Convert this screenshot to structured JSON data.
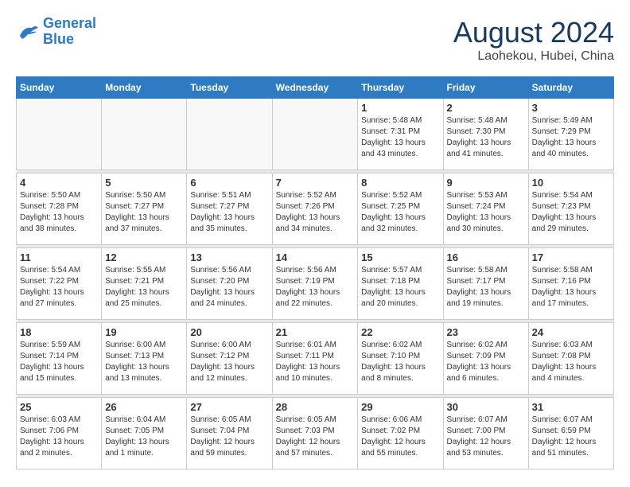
{
  "logo": {
    "line1": "General",
    "line2": "Blue"
  },
  "title": "August 2024",
  "subtitle": "Laohekou, Hubei, China",
  "weekdays": [
    "Sunday",
    "Monday",
    "Tuesday",
    "Wednesday",
    "Thursday",
    "Friday",
    "Saturday"
  ],
  "weeks": [
    [
      {
        "day": "",
        "info": ""
      },
      {
        "day": "",
        "info": ""
      },
      {
        "day": "",
        "info": ""
      },
      {
        "day": "",
        "info": ""
      },
      {
        "day": "1",
        "info": "Sunrise: 5:48 AM\nSunset: 7:31 PM\nDaylight: 13 hours\nand 43 minutes."
      },
      {
        "day": "2",
        "info": "Sunrise: 5:48 AM\nSunset: 7:30 PM\nDaylight: 13 hours\nand 41 minutes."
      },
      {
        "day": "3",
        "info": "Sunrise: 5:49 AM\nSunset: 7:29 PM\nDaylight: 13 hours\nand 40 minutes."
      }
    ],
    [
      {
        "day": "4",
        "info": "Sunrise: 5:50 AM\nSunset: 7:28 PM\nDaylight: 13 hours\nand 38 minutes."
      },
      {
        "day": "5",
        "info": "Sunrise: 5:50 AM\nSunset: 7:27 PM\nDaylight: 13 hours\nand 37 minutes."
      },
      {
        "day": "6",
        "info": "Sunrise: 5:51 AM\nSunset: 7:27 PM\nDaylight: 13 hours\nand 35 minutes."
      },
      {
        "day": "7",
        "info": "Sunrise: 5:52 AM\nSunset: 7:26 PM\nDaylight: 13 hours\nand 34 minutes."
      },
      {
        "day": "8",
        "info": "Sunrise: 5:52 AM\nSunset: 7:25 PM\nDaylight: 13 hours\nand 32 minutes."
      },
      {
        "day": "9",
        "info": "Sunrise: 5:53 AM\nSunset: 7:24 PM\nDaylight: 13 hours\nand 30 minutes."
      },
      {
        "day": "10",
        "info": "Sunrise: 5:54 AM\nSunset: 7:23 PM\nDaylight: 13 hours\nand 29 minutes."
      }
    ],
    [
      {
        "day": "11",
        "info": "Sunrise: 5:54 AM\nSunset: 7:22 PM\nDaylight: 13 hours\nand 27 minutes."
      },
      {
        "day": "12",
        "info": "Sunrise: 5:55 AM\nSunset: 7:21 PM\nDaylight: 13 hours\nand 25 minutes."
      },
      {
        "day": "13",
        "info": "Sunrise: 5:56 AM\nSunset: 7:20 PM\nDaylight: 13 hours\nand 24 minutes."
      },
      {
        "day": "14",
        "info": "Sunrise: 5:56 AM\nSunset: 7:19 PM\nDaylight: 13 hours\nand 22 minutes."
      },
      {
        "day": "15",
        "info": "Sunrise: 5:57 AM\nSunset: 7:18 PM\nDaylight: 13 hours\nand 20 minutes."
      },
      {
        "day": "16",
        "info": "Sunrise: 5:58 AM\nSunset: 7:17 PM\nDaylight: 13 hours\nand 19 minutes."
      },
      {
        "day": "17",
        "info": "Sunrise: 5:58 AM\nSunset: 7:16 PM\nDaylight: 13 hours\nand 17 minutes."
      }
    ],
    [
      {
        "day": "18",
        "info": "Sunrise: 5:59 AM\nSunset: 7:14 PM\nDaylight: 13 hours\nand 15 minutes."
      },
      {
        "day": "19",
        "info": "Sunrise: 6:00 AM\nSunset: 7:13 PM\nDaylight: 13 hours\nand 13 minutes."
      },
      {
        "day": "20",
        "info": "Sunrise: 6:00 AM\nSunset: 7:12 PM\nDaylight: 13 hours\nand 12 minutes."
      },
      {
        "day": "21",
        "info": "Sunrise: 6:01 AM\nSunset: 7:11 PM\nDaylight: 13 hours\nand 10 minutes."
      },
      {
        "day": "22",
        "info": "Sunrise: 6:02 AM\nSunset: 7:10 PM\nDaylight: 13 hours\nand 8 minutes."
      },
      {
        "day": "23",
        "info": "Sunrise: 6:02 AM\nSunset: 7:09 PM\nDaylight: 13 hours\nand 6 minutes."
      },
      {
        "day": "24",
        "info": "Sunrise: 6:03 AM\nSunset: 7:08 PM\nDaylight: 13 hours\nand 4 minutes."
      }
    ],
    [
      {
        "day": "25",
        "info": "Sunrise: 6:03 AM\nSunset: 7:06 PM\nDaylight: 13 hours\nand 2 minutes."
      },
      {
        "day": "26",
        "info": "Sunrise: 6:04 AM\nSunset: 7:05 PM\nDaylight: 13 hours\nand 1 minute."
      },
      {
        "day": "27",
        "info": "Sunrise: 6:05 AM\nSunset: 7:04 PM\nDaylight: 12 hours\nand 59 minutes."
      },
      {
        "day": "28",
        "info": "Sunrise: 6:05 AM\nSunset: 7:03 PM\nDaylight: 12 hours\nand 57 minutes."
      },
      {
        "day": "29",
        "info": "Sunrise: 6:06 AM\nSunset: 7:02 PM\nDaylight: 12 hours\nand 55 minutes."
      },
      {
        "day": "30",
        "info": "Sunrise: 6:07 AM\nSunset: 7:00 PM\nDaylight: 12 hours\nand 53 minutes."
      },
      {
        "day": "31",
        "info": "Sunrise: 6:07 AM\nSunset: 6:59 PM\nDaylight: 12 hours\nand 51 minutes."
      }
    ]
  ]
}
